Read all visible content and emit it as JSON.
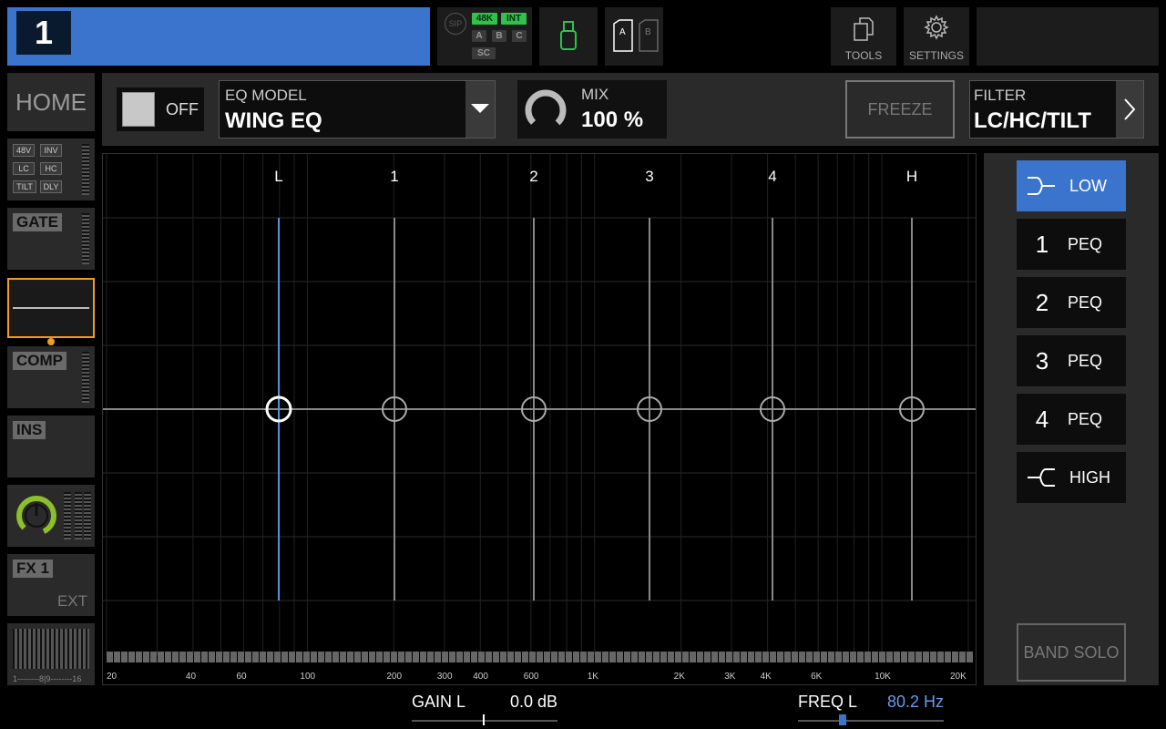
{
  "channel": {
    "number": "1"
  },
  "status": {
    "sip_label": "SIP",
    "rate": "48K",
    "clock": "INT",
    "inputs": [
      "A",
      "B",
      "C"
    ],
    "sc": "SC"
  },
  "card": {
    "slot_a": "A",
    "slot_b": "B"
  },
  "toolbar": {
    "tools_label": "TOOLS",
    "settings_label": "SETTINGS"
  },
  "sidebar": {
    "home_label": "HOME",
    "pre_tags": [
      "48V",
      "INV",
      "LC",
      "HC",
      "TILT",
      "DLY"
    ],
    "gate_label": "GATE",
    "comp_label": "COMP",
    "ins_label": "INS",
    "fx_label": "FX 1",
    "fx_sub": "EXT",
    "bus_label": "1--------8|9--------16"
  },
  "eq": {
    "onoff_label": "OFF",
    "model_caption": "EQ MODEL",
    "model_value": "WING EQ",
    "mix_caption": "MIX",
    "mix_value": "100 %",
    "freeze_label": "FREEZE",
    "filter_caption": "FILTER",
    "filter_value": "LC/HC/TILT"
  },
  "graph": {
    "band_labels": [
      "L",
      "1",
      "2",
      "3",
      "4",
      "H"
    ],
    "freq_ticks": [
      "20",
      "40",
      "60",
      "100",
      "200",
      "300",
      "400",
      "600",
      "1K",
      "2K",
      "3K",
      "4K",
      "6K",
      "10K",
      "20K"
    ]
  },
  "bands": {
    "low": "LOW",
    "b1_num": "1",
    "b1_type": "PEQ",
    "b2_num": "2",
    "b2_type": "PEQ",
    "b3_num": "3",
    "b3_type": "PEQ",
    "b4_num": "4",
    "b4_type": "PEQ",
    "high": "HIGH",
    "solo": "BAND SOLO"
  },
  "params": {
    "gain_label": "GAIN L",
    "gain_value": "0.0 dB",
    "freq_label": "FREQ L",
    "freq_value": "80.2 Hz"
  },
  "colors": {
    "accent": "#3b74cc",
    "selection": "#f39c1e",
    "active_green": "#2ec24a",
    "freq_value": "#6a9ae8"
  }
}
